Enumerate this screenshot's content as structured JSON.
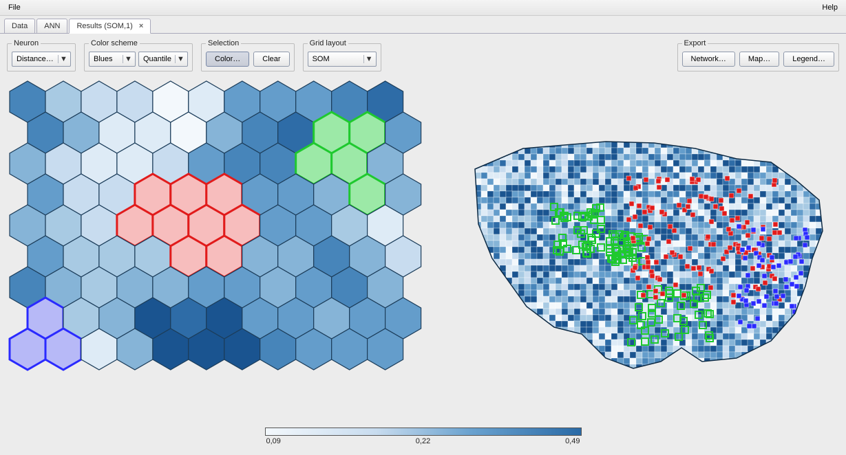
{
  "menu": {
    "file": "File",
    "help": "Help"
  },
  "tabs": [
    {
      "label": "Data",
      "active": false,
      "closable": false
    },
    {
      "label": "ANN",
      "active": false,
      "closable": false
    },
    {
      "label": "Results (SOM,1)",
      "active": true,
      "closable": true
    }
  ],
  "toolbar": {
    "neuron": {
      "legend": "Neuron",
      "value": "Distance…"
    },
    "color_scheme": {
      "legend": "Color scheme",
      "palette": "Blues",
      "scale": "Quantile"
    },
    "selection": {
      "legend": "Selection",
      "color_btn": "Color…",
      "clear_btn": "Clear"
    },
    "grid_layout": {
      "legend": "Grid layout",
      "value": "SOM"
    },
    "export": {
      "legend": "Export",
      "network_btn": "Network…",
      "map_btn": "Map…",
      "legend_btn": "Legend…"
    }
  },
  "legend_scale": {
    "min": "0,09",
    "mid": "0,22",
    "max": "0,49"
  },
  "hex_grid": {
    "cols": 11,
    "rows": 9,
    "shade": [
      [
        6,
        3,
        2,
        2,
        0,
        1,
        5,
        5,
        5,
        6,
        7
      ],
      [
        6,
        4,
        1,
        1,
        0,
        4,
        6,
        7,
        8,
        7,
        5
      ],
      [
        4,
        2,
        1,
        1,
        2,
        5,
        6,
        6,
        6,
        5,
        4
      ],
      [
        5,
        2,
        2,
        2,
        2,
        3,
        5,
        5,
        4,
        5,
        4
      ],
      [
        4,
        3,
        2,
        2,
        2,
        3,
        5,
        5,
        5,
        3,
        1
      ],
      [
        5,
        3,
        3,
        3,
        4,
        4,
        4,
        4,
        6,
        4,
        2
      ],
      [
        6,
        4,
        3,
        4,
        4,
        5,
        5,
        4,
        5,
        6,
        4
      ],
      [
        4,
        3,
        4,
        8,
        7,
        8,
        5,
        5,
        4,
        5,
        5
      ],
      [
        3,
        2,
        1,
        4,
        8,
        8,
        8,
        6,
        5,
        5,
        5
      ]
    ],
    "selections": {
      "red": [
        [
          3,
          3
        ],
        [
          3,
          4
        ],
        [
          3,
          5
        ],
        [
          4,
          3
        ],
        [
          4,
          4
        ],
        [
          4,
          5
        ],
        [
          4,
          6
        ],
        [
          5,
          4
        ],
        [
          5,
          5
        ]
      ],
      "green": [
        [
          1,
          8
        ],
        [
          1,
          9
        ],
        [
          2,
          8
        ],
        [
          2,
          9
        ],
        [
          3,
          9
        ]
      ],
      "blue": [
        [
          7,
          0
        ],
        [
          8,
          0
        ],
        [
          8,
          1
        ]
      ]
    }
  },
  "map": {
    "description": "US counties choropleth",
    "highlight_colors": {
      "red": "#e11b1b",
      "green": "#1fc92f",
      "blue": "#2a2aff"
    }
  }
}
